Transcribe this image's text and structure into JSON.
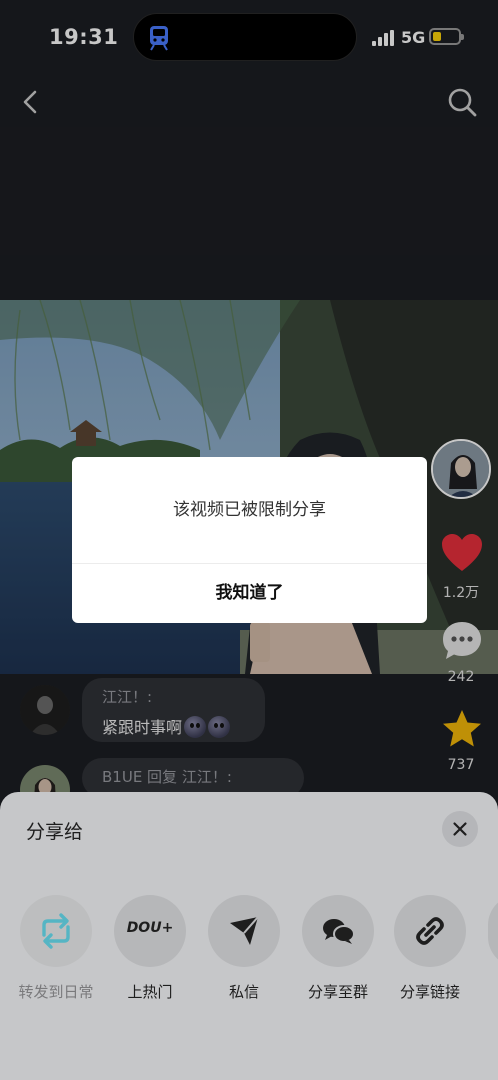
{
  "status_bar": {
    "time": "19:31",
    "network": "5G"
  },
  "video": {
    "likes": "1.2万",
    "comments": "242",
    "favorites": "737"
  },
  "comments": [
    {
      "name": "江江！:",
      "text": "紧跟时事啊"
    },
    {
      "name": "B1UE 回复 江江！:",
      "text": ""
    }
  ],
  "share_sheet": {
    "title": "分享给",
    "items": [
      {
        "label": "转发到日常",
        "icon": "repost-icon"
      },
      {
        "label": "上热门",
        "icon": "dou-plus-icon",
        "icon_text": "DOU+"
      },
      {
        "label": "私信",
        "icon": "send-icon"
      },
      {
        "label": "分享至群",
        "icon": "group-chat-icon"
      },
      {
        "label": "分享链接",
        "icon": "link-icon"
      }
    ]
  },
  "dialog": {
    "message": "该视频已被限制分享",
    "confirm_label": "我知道了"
  },
  "colors": {
    "like": "#e8303d",
    "favorite": "#f5b90a",
    "repost": "#55b5c4",
    "battery": "#ffd50a",
    "transit_icon": "#4b7cff"
  }
}
